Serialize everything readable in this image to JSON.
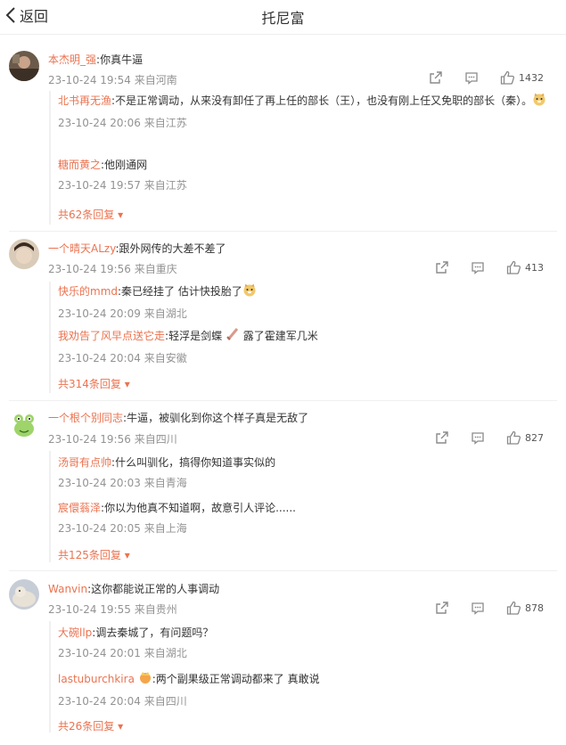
{
  "header": {
    "back_label": "返回",
    "title": "托尼富"
  },
  "colors": {
    "username": "#eb7350",
    "meta": "#939393",
    "text": "#333333"
  },
  "comments": [
    {
      "user": "本杰明_强",
      "sep": ":",
      "text": "你真牛逼",
      "date": "23-10-24 19:54",
      "location": "来自河南",
      "likes": "1432",
      "replies": [
        {
          "user": "北书再无渔",
          "sep": ":",
          "text": "不是正常调动，从来没有卸任了再上任的部长（王），也没有刚上任又免职的部长（秦）。",
          "emoji": "doge-emoji",
          "date": "23-10-24 20:06",
          "location": "来自江苏"
        },
        {
          "user": "糖而黄之",
          "sep": ":",
          "text": "他刚通网",
          "date": "23-10-24 19:57",
          "location": "来自江苏"
        }
      ],
      "more": "共62条回复"
    },
    {
      "user": "一个晴天ALzy",
      "sep": ":",
      "text": "跟外网传的大差不差了",
      "date": "23-10-24 19:56",
      "location": "来自重庆",
      "likes": "413",
      "replies": [
        {
          "user": "快乐的mmd",
          "sep": ":",
          "text": "秦已经挂了 估计快投胎了",
          "emoji": "doge-emoji",
          "date": "23-10-24 20:09",
          "location": "来自湖北"
        },
        {
          "user": "我劝告了风早点送它走",
          "sep": ":",
          "text": "轻浮是剑蝶",
          "emoji": "sword-emoji",
          "text2": "露了霍建军几米",
          "date": "23-10-24 20:04",
          "location": "来自安徽"
        }
      ],
      "more": "共314条回复"
    },
    {
      "user": "一个根个别同志",
      "sep": ":",
      "text": "牛逼，被驯化到你这个样子真是无敌了",
      "date": "23-10-24 19:56",
      "location": "来自四川",
      "likes": "827",
      "replies": [
        {
          "user": "汤哥有点帅",
          "sep": ":",
          "text": "什么叫驯化，搞得你知道事实似的",
          "date": "23-10-24 20:03",
          "location": "来自青海"
        },
        {
          "user": "宸儇蓊泽",
          "sep": ":",
          "text": "你以为他真不知道啊，故意引人评论......",
          "date": "23-10-24 20:05",
          "location": "来自上海"
        }
      ],
      "more": "共125条回复"
    },
    {
      "user": "Wanvin",
      "sep": ":",
      "text": "这你都能说正常的人事调动",
      "date": "23-10-24 19:55",
      "location": "来自贵州",
      "likes": "878",
      "replies": [
        {
          "user": "大碗llp",
          "sep": ":",
          "text": "调去秦城了，有问题吗？",
          "date": "23-10-24 20:01",
          "location": "来自湖北"
        },
        {
          "user": "lastuburchkira",
          "badge": "crown-badge-icon",
          "sep": ":",
          "text": "两个副果级正常调动都来了 真敢说",
          "date": "23-10-24 20:04",
          "location": "来自四川"
        }
      ],
      "more": "共26条回复"
    }
  ]
}
